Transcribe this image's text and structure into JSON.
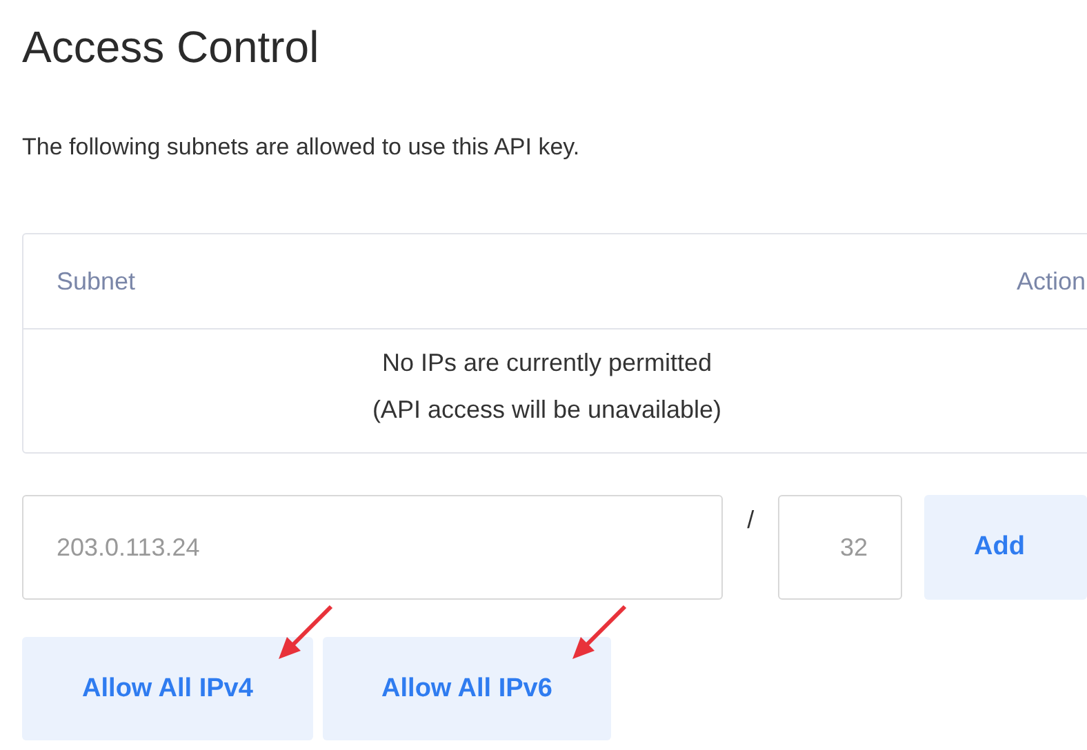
{
  "title": "Access Control",
  "description": "The following subnets are allowed to use this API key.",
  "table": {
    "columns": [
      "Subnet",
      "Action"
    ],
    "empty_message": [
      "No IPs are currently permitted",
      "(API access will be unavailable)"
    ]
  },
  "form": {
    "subnet": {
      "placeholder": "203.0.113.24"
    },
    "separator": "/",
    "prefix": {
      "placeholder": "32"
    },
    "add_button": "Add"
  },
  "buttons": [
    "Allow All IPv4",
    "Allow All IPv6"
  ]
}
